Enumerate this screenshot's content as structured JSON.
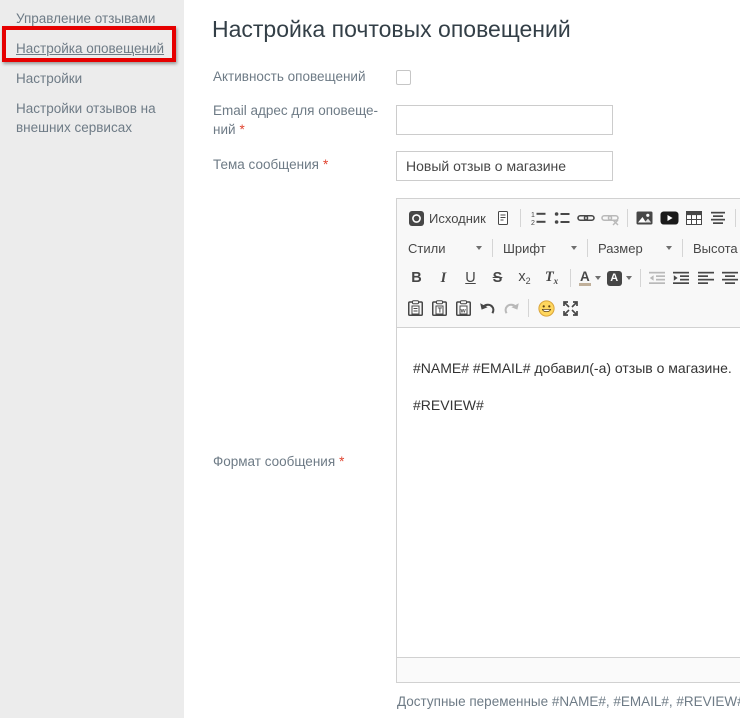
{
  "colors": {
    "annotation_red": "#e60000",
    "sidebar_bg": "#ececec",
    "muted_text": "#6e7b86",
    "title_text": "#333f47",
    "asterisk": "#e0432f",
    "editor_border": "#d1d1d1",
    "toolbar_bg": "#f8f8f8",
    "icon": "#474747"
  },
  "sidebar": {
    "items": [
      {
        "label": "Управление отзывами",
        "active": false
      },
      {
        "label": "Настройка оповещений",
        "active": true,
        "highlighted": true
      },
      {
        "label": "Настройки",
        "active": false
      },
      {
        "label": "Настройки отзывов на внешних сервисах",
        "active": false
      }
    ]
  },
  "main": {
    "title": "Настройка почтовых оповещений",
    "fields": {
      "activity": {
        "label": "Активность оповещений",
        "checked": false
      },
      "email": {
        "label": "Email адрес для оповеще­ний",
        "required_mark": "*",
        "value": ""
      },
      "subject": {
        "label": "Тема сообщения",
        "required_mark": "*",
        "value": "Новый отзыв о магазине"
      },
      "format": {
        "label": "Формат сообщения",
        "required_mark": "*"
      }
    },
    "editor": {
      "toolbar": {
        "source_label": "Исходник",
        "styles_label": "Стили",
        "font_label": "Шрифт",
        "size_label": "Размер",
        "line_height_label": "Высота ...",
        "glyphs": {
          "bold": "B",
          "italic": "I",
          "underline": "U",
          "strikethrough": "S",
          "sub_base": "x",
          "sub_mark": "2",
          "removeformat_base": "T",
          "removeformat_mark": "x",
          "textcolor": "A",
          "bgcolor": "A"
        },
        "row1_icons": [
          "source",
          "templates",
          "numbered-list",
          "bulleted-list",
          "link",
          "unlink",
          "image",
          "youtube",
          "table",
          "horizontal-rule"
        ],
        "row3_icons": [
          "bold",
          "italic",
          "underline",
          "strikethrough",
          "subscript",
          "remove-format",
          "text-color",
          "background-color",
          "decrease-indent",
          "increase-indent",
          "align-left",
          "align-center"
        ],
        "row4_icons": [
          "paste",
          "paste-plain-text",
          "paste-from-word",
          "undo",
          "redo",
          "smiley",
          "maximize"
        ]
      },
      "content_paragraphs": [
        "#NAME# #EMAIL# добавил(-а) отзыв о магазине.",
        "#REVIEW#"
      ]
    },
    "footer_note": "Доступные переменные #NAME#, #EMAIL#, #REVIEW#"
  }
}
